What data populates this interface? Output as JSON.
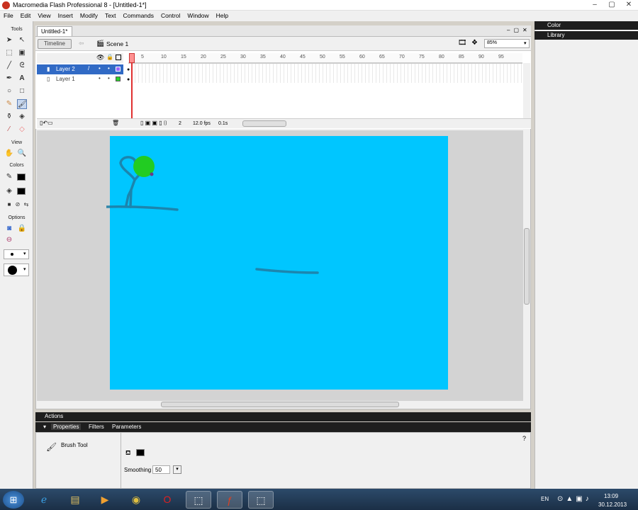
{
  "window": {
    "title": "Macromedia Flash Professional 8 - [Untitled-1*]"
  },
  "menu": [
    "File",
    "Edit",
    "View",
    "Insert",
    "Modify",
    "Text",
    "Commands",
    "Control",
    "Window",
    "Help"
  ],
  "tools": {
    "section_tools": "Tools",
    "section_view": "View",
    "section_colors": "Colors",
    "section_options": "Options"
  },
  "document": {
    "tab": "Untitled-1*",
    "timeline_button": "Timeline",
    "scene": "Scene 1",
    "zoom": "85%"
  },
  "timeline": {
    "layers": [
      {
        "name": "Layer 2",
        "selected": true
      },
      {
        "name": "Layer 1",
        "selected": false
      }
    ],
    "ruler": [
      "5",
      "10",
      "15",
      "20",
      "25",
      "30",
      "35",
      "40",
      "45",
      "50",
      "55",
      "60",
      "65",
      "70",
      "75",
      "80",
      "85",
      "90",
      "95"
    ],
    "current_frame": "2",
    "fps": "12.0 fps",
    "time": "0.1s"
  },
  "panels": {
    "actions": "Actions",
    "properties_tabs": [
      "Properties",
      "Filters",
      "Parameters"
    ],
    "color": "Color",
    "library": "Library"
  },
  "properties": {
    "tool_name": "Brush Tool",
    "smoothing_label": "Smoothing",
    "smoothing_value": "50"
  },
  "colors": {
    "stage": "#00c6ff",
    "stroke_drawn": "#2a7ea0",
    "ball": "#22cc22"
  },
  "taskbar": {
    "lang": "EN",
    "time": "13:09",
    "date": "30.12.2013"
  }
}
